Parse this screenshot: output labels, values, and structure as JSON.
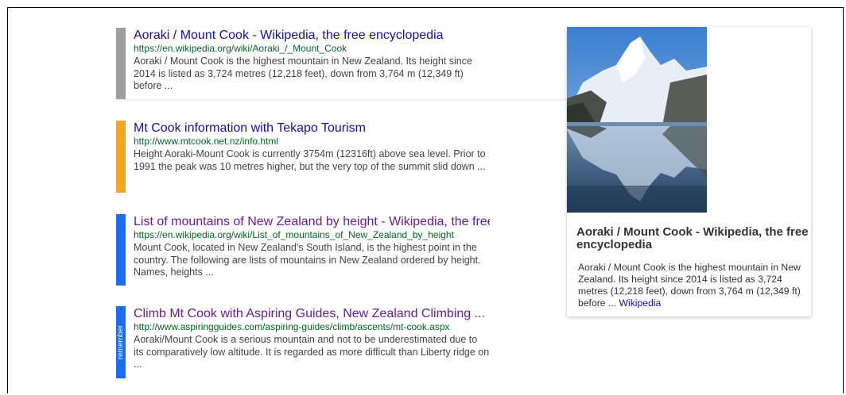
{
  "results": [
    {
      "title": "Aoraki / Mount Cook - Wikipedia, the free encyclopedia",
      "url": "https://en.wikipedia.org/wiki/Aoraki_/_Mount_Cook",
      "snippet": "Aoraki / Mount Cook is the highest mountain in New Zealand. Its height since 2014 is listed as 3,724 metres (12,218 feet), down from 3,764 m (12,349 ft) before  ...",
      "bar_color": "#9e9e9e"
    },
    {
      "title": "Mt Cook information with Tekapo Tourism",
      "url": "http://www.mtcook.net.nz/info.html",
      "snippet": "Height Aoraki-Mount Cook is currently 3754m (12316ft) above sea level. Prior to 1991 the peak was 10 metres higher, but the very top of the summit slid down ...",
      "bar_color": "#f5a623"
    },
    {
      "title": "List of mountains of New Zealand by height - Wikipedia, the free encyclopedia",
      "url": "https://en.wikipedia.org/wiki/List_of_mountains_of_New_Zealand_by_height",
      "snippet": "Mount Cook, located in New Zealand's South Island, is the highest point in the country. The following are lists of mountains in New Zealand ordered by height. Names, heights ...",
      "bar_color": "#1a6ef5"
    },
    {
      "title": "Climb Mt Cook with Aspiring Guides, New Zealand Climbing ...",
      "url": "http://www.aspiringguides.com/aspiring-guides/climb/ascents/mt-cook.aspx",
      "snippet": "Aoraki/Mount Cook is a serious mountain and not to be underestimated due to its comparatively low altitude. It is regarded as more difficult than Liberty ridge on ...",
      "bar_color": "#1a6ef5",
      "bar_label": "remember"
    }
  ],
  "panel": {
    "title": "Aoraki / Mount Cook - Wikipedia, the free encyclopedia",
    "body": "Aoraki / Mount Cook is the highest mountain in New Zealand. Its height since 2014 is listed as 3,724 metres (12,218 feet), down from 3,764 m (12,349 ft) before  ... ",
    "source_link": "Wikipedia",
    "image_alt": "mountain-lake-photo"
  }
}
